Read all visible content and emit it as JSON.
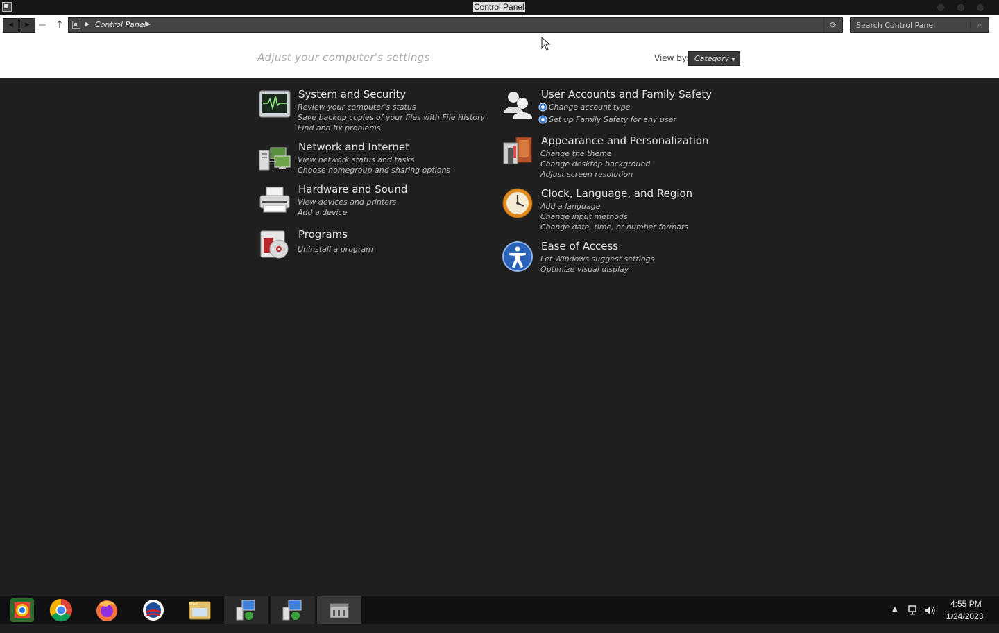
{
  "window": {
    "title": "Control Panel"
  },
  "address_bar": {
    "breadcrumb": "Control Panel",
    "search_placeholder": "Search Control Panel"
  },
  "header": {
    "heading": "Adjust your computer's settings",
    "view_by_label": "View by:",
    "view_by_value": "Category"
  },
  "categories": [
    {
      "title": "System and Security",
      "icon": "system-security-icon",
      "links": [
        "Review your computer's status",
        "Save backup copies of your files with File History",
        "Find and fix problems"
      ]
    },
    {
      "title": "Network and Internet",
      "icon": "network-icon",
      "links": [
        "View network status and tasks",
        "Choose homegroup and sharing options"
      ]
    },
    {
      "title": "Hardware and Sound",
      "icon": "printer-icon",
      "links": [
        "View devices and printers",
        "Add a device"
      ]
    },
    {
      "title": "Programs",
      "icon": "programs-icon",
      "links": [
        "Uninstall a program"
      ]
    },
    {
      "title": "User Accounts and Family Safety",
      "icon": "users-icon",
      "links": [
        "Change account type",
        "Set up Family Safety for any user"
      ]
    },
    {
      "title": "Appearance and Personalization",
      "icon": "appearance-icon",
      "links": [
        "Change the theme",
        "Change desktop background",
        "Adjust screen resolution"
      ]
    },
    {
      "title": "Clock, Language, and Region",
      "icon": "clock-icon",
      "links": [
        "Add a language",
        "Change input methods",
        "Change date, time, or number formats"
      ]
    },
    {
      "title": "Ease of Access",
      "icon": "accessibility-icon",
      "links": [
        "Let Windows suggest settings",
        "Optimize visual display"
      ]
    }
  ],
  "taskbar": {
    "apps": [
      "chrome-beta-icon",
      "chrome-icon",
      "firefox-icon",
      "obama-logo-icon",
      "file-explorer-icon",
      "network-settings-icon",
      "network-settings-icon",
      "control-panel-icon"
    ],
    "time": "4:55 PM",
    "date": "1/24/2023"
  },
  "colors": {
    "background": "#1f1f1f",
    "header": "#ffffff",
    "taskbar": "#111111"
  }
}
